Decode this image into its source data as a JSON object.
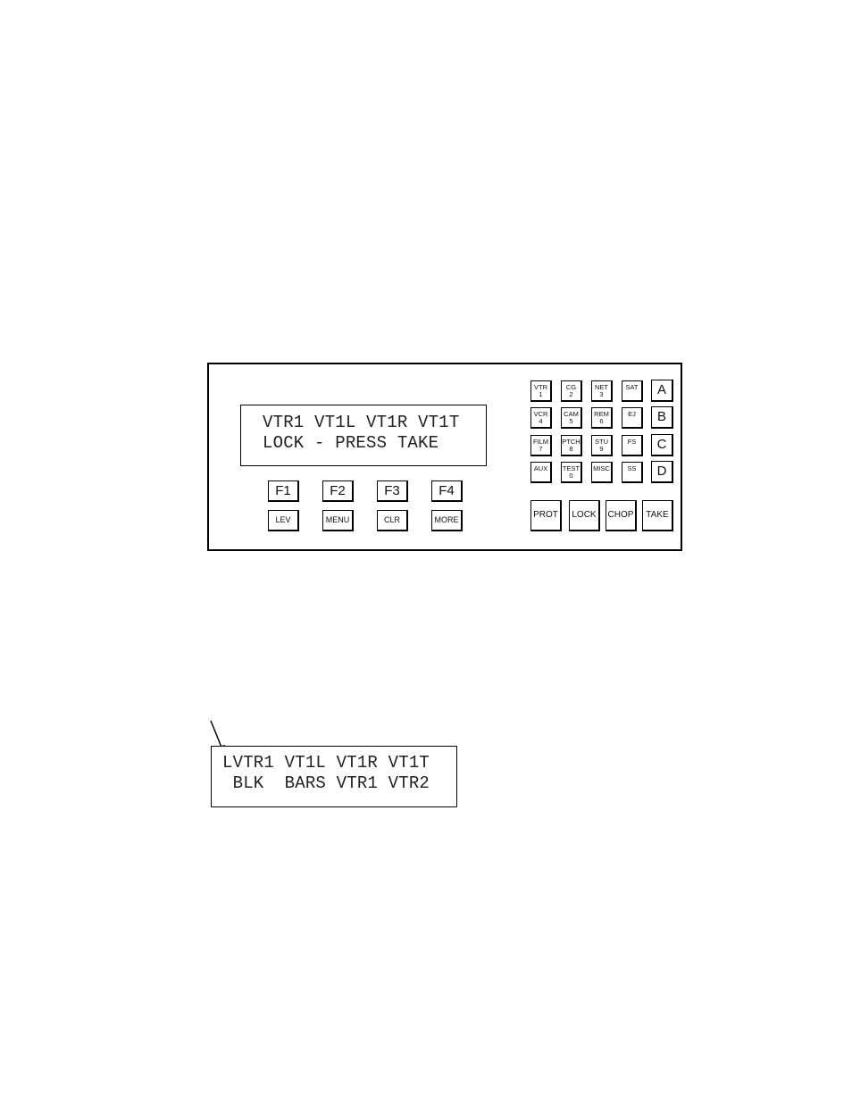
{
  "panel": {
    "display": {
      "line1": "VTR1 VT1L VT1R VT1T",
      "line2": "LOCK - PRESS TAKE"
    },
    "function_keys": [
      {
        "label": "F1",
        "sub_label": "LEV"
      },
      {
        "label": "F2",
        "sub_label": "MENU"
      },
      {
        "label": "F3",
        "sub_label": "CLR"
      },
      {
        "label": "F4",
        "sub_label": "MORE"
      }
    ],
    "source_keys": [
      [
        {
          "name": "VTR",
          "num": "1"
        },
        {
          "name": "CG",
          "num": "2"
        },
        {
          "name": "NET",
          "num": "3"
        },
        {
          "name": "SAT",
          "num": ""
        }
      ],
      [
        {
          "name": "VCR",
          "num": "4"
        },
        {
          "name": "CAM",
          "num": "5"
        },
        {
          "name": "REM",
          "num": "6"
        },
        {
          "name": "EJ",
          "num": ""
        }
      ],
      [
        {
          "name": "FILM",
          "num": "7"
        },
        {
          "name": "PTCH",
          "num": "8"
        },
        {
          "name": "STU",
          "num": "9"
        },
        {
          "name": "FS",
          "num": ""
        }
      ],
      [
        {
          "name": "AUX",
          "num": ""
        },
        {
          "name": "TEST",
          "num": "0"
        },
        {
          "name": "MISC",
          "num": ""
        },
        {
          "name": "SS",
          "num": ""
        }
      ]
    ],
    "bus_keys": [
      "A",
      "B",
      "C",
      "D"
    ],
    "control_keys": [
      "PROT",
      "LOCK",
      "CHOP",
      "TAKE"
    ]
  },
  "alt_display": {
    "line1": "LVTR1 VT1L VT1R VT1T",
    "line2": " BLK  BARS VTR1 VTR2",
    "pointer": "arrow-indicator"
  }
}
